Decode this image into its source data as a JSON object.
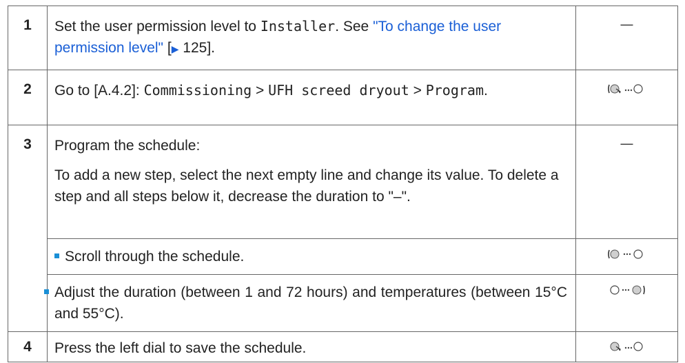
{
  "steps": [
    {
      "num": "1",
      "t1": "Set the user permission level to ",
      "t2": "Installer",
      "t3": ". See ",
      "link": "\"To change the user permission level\"",
      "t4": " [",
      "t5": " 125].",
      "icon_text": "—"
    },
    {
      "num": "2",
      "t1": "Go to [A.4.2]: ",
      "m1": "Commissioning",
      "sep1": " > ",
      "m2": "UFH screed dryout",
      "sep2": " > ",
      "m3": "Program",
      "t2": ".",
      "icon": "press-left-dial-icon"
    },
    {
      "num": "3",
      "p1": "Program the schedule:",
      "p2": "To add a new step, select the next empty line and change its value. To delete a step and all steps below it, decrease the duration to \"–\".",
      "icon_text": "—",
      "sub": [
        {
          "text": "Scroll through the schedule.",
          "icon": "turn-left-dial-icon"
        },
        {
          "text": "Adjust the duration (between 1 and 72 hours) and temperatures (between 15°C and 55°C).",
          "icon": "turn-right-dial-icon"
        }
      ]
    },
    {
      "num": "4",
      "text": "Press the left dial to save the schedule.",
      "icon": "press-left-dial-icon"
    }
  ]
}
